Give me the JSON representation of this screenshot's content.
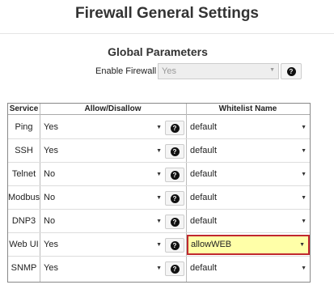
{
  "page": {
    "title": "Firewall General Settings"
  },
  "global": {
    "title": "Global Parameters",
    "enable_label": "Enable Firewall",
    "enable_value": "Yes"
  },
  "table": {
    "headers": {
      "service": "Service",
      "allow": "Allow/Disallow",
      "whitelist": "Whitelist Name"
    },
    "rows": [
      {
        "service": "Ping",
        "allow": "Yes",
        "whitelist": "default"
      },
      {
        "service": "SSH",
        "allow": "Yes",
        "whitelist": "default"
      },
      {
        "service": "Telnet",
        "allow": "No",
        "whitelist": "default"
      },
      {
        "service": "Modbus",
        "allow": "No",
        "whitelist": "default"
      },
      {
        "service": "DNP3",
        "allow": "No",
        "whitelist": "default"
      },
      {
        "service": "Web UI",
        "allow": "Yes",
        "whitelist": "allowWEB"
      },
      {
        "service": "SNMP",
        "allow": "Yes",
        "whitelist": "default"
      }
    ]
  },
  "icons": {
    "help": "question-circle-icon",
    "dropdown": "caret-down-icon"
  },
  "colors": {
    "highlight_fill": "#ffffa8",
    "highlight_border": "#c0282e"
  }
}
